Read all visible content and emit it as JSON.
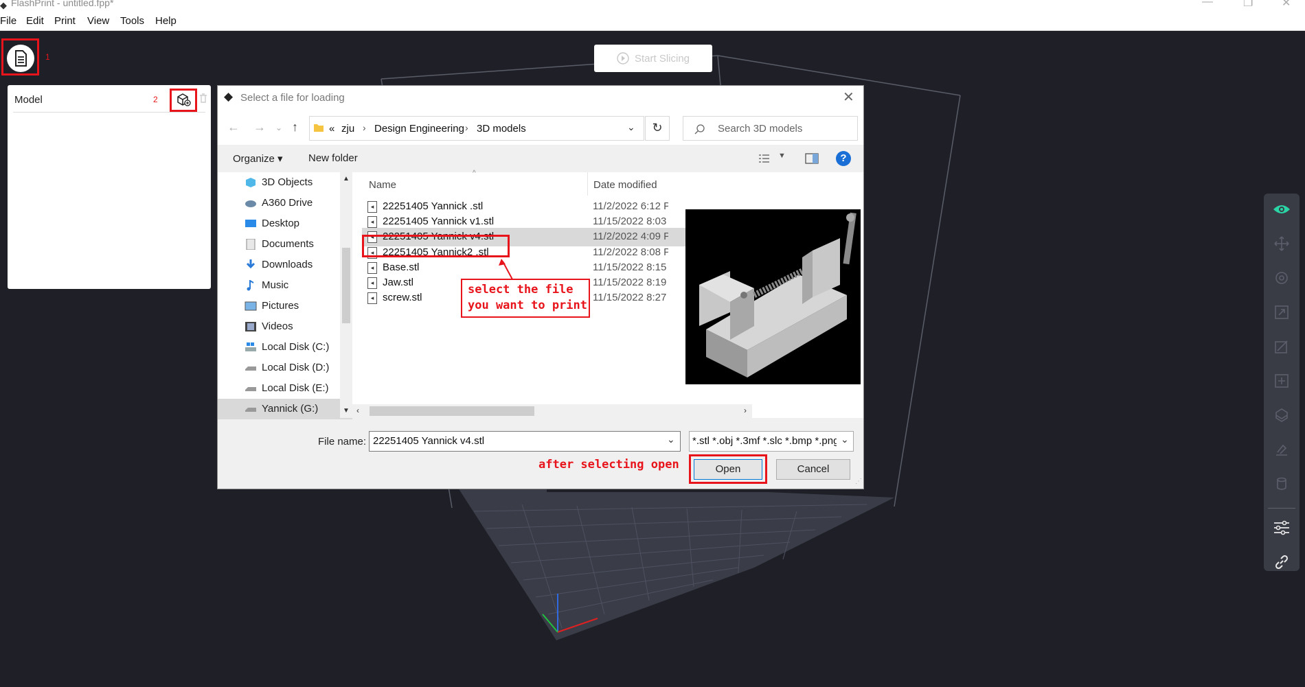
{
  "window": {
    "title": "FlashPrint - untitled.fpp*",
    "controls": [
      "minimize",
      "restore",
      "close"
    ]
  },
  "menu": [
    "File",
    "Edit",
    "Print",
    "View",
    "Tools",
    "Help"
  ],
  "left_panel": {
    "file_button_number": "1",
    "model_title": "Model",
    "add_model_number": "2"
  },
  "start_slicing": "Start Slicing",
  "dialog": {
    "title": "Select a file for loading",
    "breadcrumbs": [
      "«",
      "zju",
      "Design Engineering",
      "3D models"
    ],
    "search_placeholder": "Search 3D models",
    "organize": "Organize",
    "new_folder": "New folder",
    "nav_items": [
      {
        "label": "3D Objects",
        "icon": "3d-objects-icon"
      },
      {
        "label": "A360 Drive",
        "icon": "cloud-drive-icon"
      },
      {
        "label": "Desktop",
        "icon": "desktop-icon"
      },
      {
        "label": "Documents",
        "icon": "documents-icon"
      },
      {
        "label": "Downloads",
        "icon": "downloads-icon"
      },
      {
        "label": "Music",
        "icon": "music-icon"
      },
      {
        "label": "Pictures",
        "icon": "pictures-icon"
      },
      {
        "label": "Videos",
        "icon": "videos-icon"
      },
      {
        "label": "Local Disk (C:)",
        "icon": "system-disk-icon"
      },
      {
        "label": "Local Disk (D:)",
        "icon": "disk-icon"
      },
      {
        "label": "Local Disk (E:)",
        "icon": "disk-icon"
      },
      {
        "label": "Yannick (G:)",
        "icon": "disk-icon",
        "selected": true
      }
    ],
    "columns": {
      "name": "Name",
      "date": "Date modified"
    },
    "files": [
      {
        "name": "22251405 Yannick .stl",
        "date": "11/2/2022 6:12 P"
      },
      {
        "name": "22251405 Yannick v1.stl",
        "date": "11/15/2022 8:03"
      },
      {
        "name": "22251405 Yannick v4.stl",
        "date": "11/2/2022 4:09 P",
        "selected": true
      },
      {
        "name": "22251405 Yannick2 .stl",
        "date": "11/2/2022 8:08 P"
      },
      {
        "name": "Base.stl",
        "date": "11/15/2022 8:15"
      },
      {
        "name": "Jaw.stl",
        "date": "11/15/2022 8:19"
      },
      {
        "name": "screw.stl",
        "date": "11/15/2022 8:27"
      }
    ],
    "file_name_label": "File name:",
    "file_name_value": "22251405 Yannick v4.stl",
    "filter": "*.stl *.obj *.3mf *.slc *.bmp *.png",
    "open": "Open",
    "cancel": "Cancel"
  },
  "annotations": {
    "select_line1": "select the file",
    "select_line2": "you want to print",
    "after": "after selecting open"
  },
  "right_toolbar": [
    "eye-icon",
    "move-icon",
    "rotate-icon",
    "scale-icon",
    "cut-icon",
    "add-support-icon",
    "layers-icon",
    "land-icon",
    "cylinder-icon",
    "settings-sliders-icon",
    "link-icon"
  ],
  "colors": {
    "accent": "#2bd4a4",
    "annotation": "#e8141b",
    "background": "#1f2027"
  }
}
